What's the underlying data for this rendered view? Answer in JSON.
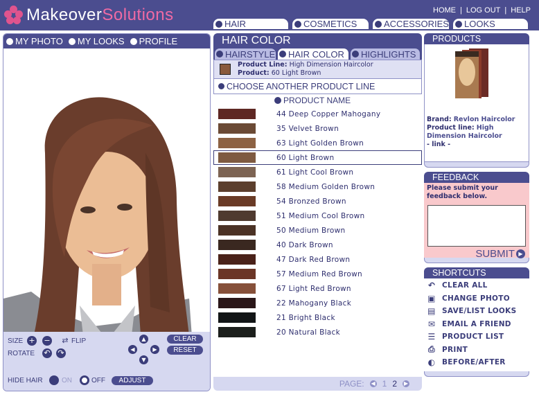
{
  "brand": {
    "name_part1": "Makeover",
    "name_part2": "Solutions"
  },
  "toplinks": [
    "HOME",
    "LOG OUT",
    "HELP"
  ],
  "maintabs": [
    "HAIR",
    "COSMETICS",
    "ACCESSORIES",
    "LOOKS"
  ],
  "left": {
    "tabs": [
      "MY PHOTO",
      "MY LOOKS",
      "PROFILE"
    ],
    "controls": {
      "size": "SIZE",
      "flip": "FLIP",
      "rotate": "ROTATE",
      "clear": "CLEAR",
      "reset": "RESET",
      "hide_hair": "HIDE HAIR",
      "on": "ON",
      "off": "OFF",
      "adjust": "ADJUST"
    }
  },
  "middle": {
    "title": "HAIR COLOR",
    "subtabs": [
      "HAIRSTYLE",
      "HAIR COLOR",
      "HIGHLIGHTS"
    ],
    "active_subtab": "HAIR COLOR",
    "selected_product": {
      "line_label": "Product Line:",
      "line_value": "High Dimension Haircolor",
      "product_label": "Product:",
      "product_value": "60 Light Brown",
      "color": "#8a5a3c"
    },
    "choose_line": "CHOOSE ANOTHER PRODUCT LINE",
    "column_header": "PRODUCT NAME",
    "products": [
      {
        "name": "44 Deep Copper Mahogany",
        "color": "#5e2723"
      },
      {
        "name": "35 Velvet Brown",
        "color": "#6b4a35"
      },
      {
        "name": "63 Light Golden Brown",
        "color": "#8d6243"
      },
      {
        "name": "60 Light Brown",
        "color": "#7e5a41"
      },
      {
        "name": "61 Light Cool Brown",
        "color": "#7d6453"
      },
      {
        "name": "58 Medium Golden Brown",
        "color": "#5c3f2d"
      },
      {
        "name": "54 Bronzed Brown",
        "color": "#6a3b26"
      },
      {
        "name": "51 Medium Cool Brown",
        "color": "#4f3a2f"
      },
      {
        "name": "50 Medium Brown",
        "color": "#4b3225"
      },
      {
        "name": "40 Dark Brown",
        "color": "#3a2820"
      },
      {
        "name": "47 Dark Red Brown",
        "color": "#4a2219"
      },
      {
        "name": "57 Medium Red Brown",
        "color": "#6b3526"
      },
      {
        "name": "67 Light Red Brown",
        "color": "#86503a"
      },
      {
        "name": "22 Mahogany Black",
        "color": "#2a1618"
      },
      {
        "name": "21 Bright Black",
        "color": "#121516"
      },
      {
        "name": "20 Natural Black",
        "color": "#1c1f1c"
      }
    ],
    "selected_index": 3,
    "pager": {
      "label": "PAGE:",
      "current": "1",
      "total": "2"
    }
  },
  "right": {
    "products_title": "PRODUCTS",
    "brand_label": "Brand:",
    "brand_value": "Revlon Haircolor",
    "line_label": "Product line:",
    "line_value": "High Dimension Haircolor",
    "link": "- link -",
    "feedback_title": "FEEDBACK",
    "feedback_msg": "Please submit your feedback below.",
    "submit": "SUBMIT",
    "shortcuts_title": "SHORTCUTS",
    "shortcuts": [
      {
        "label": "CLEAR ALL",
        "icon": "undo-arrow-icon"
      },
      {
        "label": "CHANGE PHOTO",
        "icon": "camera-icon"
      },
      {
        "label": "SAVE/LIST LOOKS",
        "icon": "floppy-disk-icon"
      },
      {
        "label": "EMAIL A FRIEND",
        "icon": "envelope-icon"
      },
      {
        "label": "PRODUCT LIST",
        "icon": "list-icon"
      },
      {
        "label": "PRINT",
        "icon": "printer-icon"
      },
      {
        "label": "BEFORE/AFTER",
        "icon": "before-after-icon"
      }
    ]
  }
}
